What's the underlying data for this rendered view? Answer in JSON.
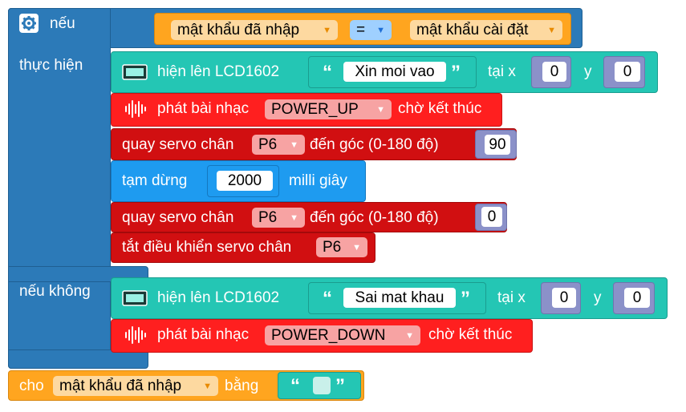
{
  "if_block": {
    "label_if": "nếu",
    "label_then": "thực hiện",
    "label_else": "nếu không",
    "condition": {
      "left_var": "mật khẩu đã nhập",
      "operator": "=",
      "right_var": "mật khẩu cài đặt"
    }
  },
  "then_blocks": {
    "lcd": {
      "label": "hiện lên LCD1602",
      "text": "Xin moi vao",
      "at_x_label": "tại x",
      "x": "0",
      "y_label": "y",
      "y": "0"
    },
    "music": {
      "label": "phát bài nhạc",
      "tune": "POWER_UP",
      "suffix": "chờ kết thúc"
    },
    "servo1": {
      "label": "quay servo chân",
      "pin": "P6",
      "angle_label": "đến góc (0-180 độ)",
      "angle": "90"
    },
    "wait": {
      "label": "tạm dừng",
      "ms": "2000",
      "unit": "milli giây"
    },
    "servo2": {
      "label": "quay servo chân",
      "pin": "P6",
      "angle_label": "đến góc (0-180 độ)",
      "angle": "0"
    },
    "servo_off": {
      "label": "tắt điều khiển servo chân",
      "pin": "P6"
    }
  },
  "else_blocks": {
    "lcd": {
      "label": "hiện lên LCD1602",
      "text": "Sai mat khau",
      "at_x_label": "tại x",
      "x": "0",
      "y_label": "y",
      "y": "0"
    },
    "music": {
      "label": "phát bài nhạc",
      "tune": "POWER_DOWN",
      "suffix": "chờ kết thúc"
    }
  },
  "set_block": {
    "label": "cho",
    "var": "mật khẩu đã nhập",
    "to_label": "bằng",
    "value": ""
  },
  "icons": {
    "gear": "gear-icon",
    "lcd": "lcd-icon",
    "music": "music-wave-icon",
    "dropdown": "dropdown-arrow-icon",
    "quote_open": "quote-open-icon",
    "quote_close": "quote-close-icon"
  },
  "colors": {
    "if": "#2c7ab8",
    "lcd": "#24c6b4",
    "music": "#ff1f1f",
    "servo": "#d10f11",
    "wait": "#1e9bf0",
    "variable": "#ffa51f",
    "number": "#8b91c9"
  }
}
